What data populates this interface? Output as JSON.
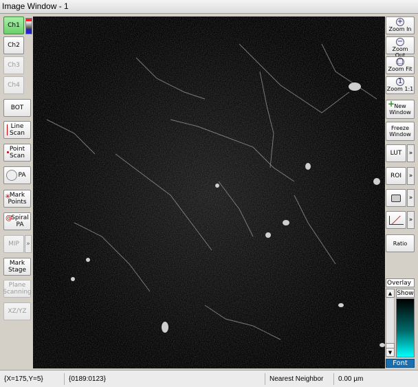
{
  "window": {
    "title": "Image Window - 1"
  },
  "left_toolbar": {
    "ch1": "Ch1",
    "ch2": "Ch2",
    "ch3": "Ch3",
    "ch4": "Ch4",
    "bot": "BOT",
    "line_scan": [
      "Line",
      "Scan"
    ],
    "point_scan": [
      "Point",
      "Scan"
    ],
    "pa": "PA",
    "mark_points": [
      "Mark",
      "Points"
    ],
    "spiral_pa": [
      "Spiral",
      "PA"
    ],
    "mip": "MIP",
    "mark_stage": [
      "Mark",
      "Stage"
    ],
    "plane_scanning": [
      "Plane",
      "Scanning"
    ],
    "xz_yz": "XZ/YZ"
  },
  "right_toolbar": {
    "zoom_in": "Zoom In",
    "zoom_out": "Zoom Out",
    "zoom_fit": "Zoom Fit",
    "zoom_1_1": "Zoom 1:1",
    "new_window": [
      "New",
      "Window"
    ],
    "freeze_window": [
      "Freeze",
      "Window"
    ],
    "lut": "LUT",
    "roi": "ROI",
    "ratio": "Ratio",
    "overlay": "Overlay",
    "show": "Show",
    "font": "Font"
  },
  "status": {
    "cursor": "{X=175,Y=5}",
    "value": "{0189:0123}",
    "interpolation": "Nearest Neighbor",
    "distance": "0.00 µm"
  },
  "colors": {
    "active_channel": "#6ad06a",
    "font_button": "#1a6fb0",
    "lut_top": "#000000",
    "lut_bottom": "#00ffff"
  }
}
